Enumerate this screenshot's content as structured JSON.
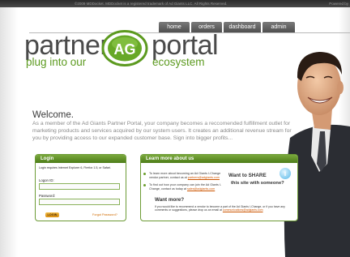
{
  "topbar": {
    "copyright": "©2009 MDDocket. MDDocket is a registered trademark of Ad Giants LLC. All Rights Reserved.",
    "powered": "Powered by"
  },
  "nav": {
    "items": [
      "home",
      "orders",
      "dashboard",
      "admin"
    ]
  },
  "logo": {
    "word1": "partner",
    "word2": "portal",
    "tag_left": "plug into our",
    "tag_right": "ecosystem",
    "mark_text": "AG"
  },
  "welcome": {
    "title": "Welcome.",
    "body": "As a member of the Ad Giants Partner Portal, your company becomes a reccomended fulfillment outlet for marketing products and services acquired by our system users. It creates an additional revenue stream for you by providing access to our expanded customer base. Sign into bigger profits..."
  },
  "login": {
    "title": "Login",
    "note": "Login requires Internet Explorer 6, Firefox 1.5, or Safari.",
    "id_label": "Logon ID:",
    "password_label": "Password:",
    "button": "LOGIN",
    "forgot": "Forgot Password?"
  },
  "learn": {
    "title": "Learn more about us",
    "item1_text": "To learn more about becoming an Ad Giants I-Change vendor partner, contact us at",
    "item1_email": "partners@adgiants.com",
    "item2_text": "To find out how your company can join the Ad Giants I-Change, contact us today at",
    "item2_email": "sales@adgiants.com",
    "share_title": "Want to SHARE",
    "share_sub": "this site with someone?",
    "bubble_icon": "i",
    "more_title": "Want more?",
    "more_text": "If you would like to recommend a vendor to become a part of the Ad Giants I-Change, or if you have any comments or suggestions, please drop us an email at",
    "more_email": "communications@adgiants.com"
  },
  "colors": {
    "accent_green": "#5c9a1f",
    "nav_grey": "#5f5f5f",
    "link_orange": "#cc5500"
  }
}
